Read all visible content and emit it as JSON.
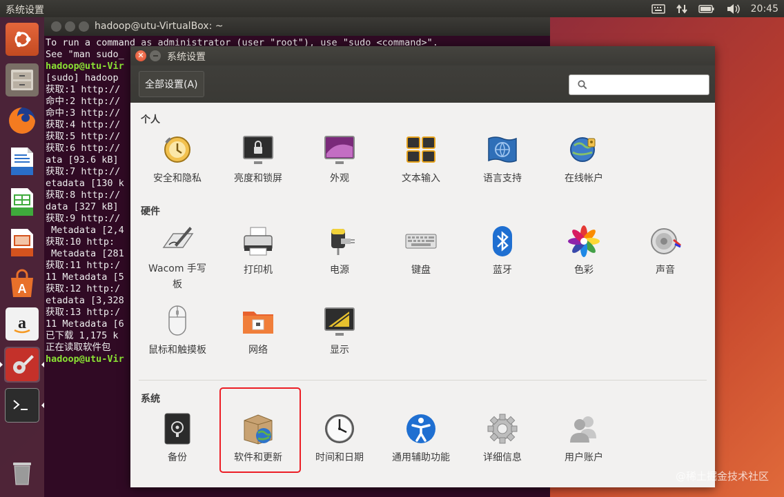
{
  "top_panel": {
    "app_title": "系统设置",
    "clock": "20:45",
    "tray_icons": [
      "keyboard-icon",
      "network-updown-icon",
      "battery-icon",
      "volume-icon"
    ]
  },
  "launcher": {
    "items": [
      {
        "name": "ubuntu-dash-icon"
      },
      {
        "name": "files-icon"
      },
      {
        "name": "firefox-icon"
      },
      {
        "name": "writer-icon"
      },
      {
        "name": "calc-icon"
      },
      {
        "name": "impress-icon"
      },
      {
        "name": "software-center-icon"
      },
      {
        "name": "amazon-icon"
      },
      {
        "name": "system-settings-icon"
      },
      {
        "name": "terminal-icon"
      },
      {
        "name": "trash-icon"
      }
    ]
  },
  "terminal": {
    "title": "hadoop@utu-VirtualBox: ~",
    "lines": [
      {
        "text": "To run a command as administrator (user \"root\"), use \"sudo <command>\".",
        "prompt": false
      },
      {
        "text": "See \"man sudo_",
        "prompt": false
      },
      {
        "text": "",
        "prompt": false
      },
      {
        "text": "hadoop@utu-Vir",
        "prompt": true
      },
      {
        "text": "[sudo] hadoop ",
        "prompt": false
      },
      {
        "text": "获取:1 http://",
        "prompt": false
      },
      {
        "text": "命中:2 http://",
        "prompt": false
      },
      {
        "text": "命中:3 http://",
        "prompt": false
      },
      {
        "text": "获取:4 http://",
        "prompt": false
      },
      {
        "text": "获取:5 http://",
        "prompt": false
      },
      {
        "text": "获取:6 http://",
        "prompt": false
      },
      {
        "text": "ata [93.6 kB]",
        "prompt": false
      },
      {
        "text": "获取:7 http://",
        "prompt": false
      },
      {
        "text": "etadata [130 k",
        "prompt": false
      },
      {
        "text": "获取:8 http://",
        "prompt": false
      },
      {
        "text": "data [327 kB]",
        "prompt": false
      },
      {
        "text": "获取:9 http://",
        "prompt": false
      },
      {
        "text": " Metadata [2,4",
        "prompt": false
      },
      {
        "text": "获取:10 http:",
        "prompt": false
      },
      {
        "text": " Metadata [281",
        "prompt": false
      },
      {
        "text": "获取:11 http:/",
        "prompt": false
      },
      {
        "text": "11 Metadata [5",
        "prompt": false
      },
      {
        "text": "获取:12 http:/",
        "prompt": false
      },
      {
        "text": "etadata [3,328",
        "prompt": false
      },
      {
        "text": "获取:13 http:/",
        "prompt": false
      },
      {
        "text": "11 Metadata [6",
        "prompt": false
      },
      {
        "text": "已下载 1,175 k",
        "prompt": false
      },
      {
        "text": "正在读取软件包",
        "prompt": false
      },
      {
        "text": "hadoop@utu-Vir",
        "prompt": true
      }
    ]
  },
  "settings": {
    "title": "系统设置",
    "all_settings_label": "全部设置(A)",
    "search_placeholder": "",
    "sections": [
      {
        "title": "个人",
        "items": [
          {
            "label": "安全和隐私",
            "icon": "security-privacy-icon"
          },
          {
            "label": "亮度和锁屏",
            "icon": "brightness-lock-icon"
          },
          {
            "label": "外观",
            "icon": "appearance-icon"
          },
          {
            "label": "文本输入",
            "icon": "text-entry-icon"
          },
          {
            "label": "语言支持",
            "icon": "language-support-icon"
          },
          {
            "label": "在线帐户",
            "icon": "online-accounts-icon"
          }
        ]
      },
      {
        "title": "硬件",
        "items": [
          {
            "label": "Wacom 手写板",
            "icon": "wacom-tablet-icon"
          },
          {
            "label": "打印机",
            "icon": "printer-icon"
          },
          {
            "label": "电源",
            "icon": "power-icon"
          },
          {
            "label": "键盘",
            "icon": "keyboard-icon"
          },
          {
            "label": "蓝牙",
            "icon": "bluetooth-icon"
          },
          {
            "label": "色彩",
            "icon": "color-icon"
          },
          {
            "label": "声音",
            "icon": "sound-icon"
          },
          {
            "label": "鼠标和触摸板",
            "icon": "mouse-touchpad-icon"
          },
          {
            "label": "网络",
            "icon": "network-icon"
          },
          {
            "label": "显示",
            "icon": "display-icon"
          }
        ]
      },
      {
        "title": "系统",
        "items": [
          {
            "label": "备份",
            "icon": "backup-icon"
          },
          {
            "label": "软件和更新",
            "icon": "software-updates-icon"
          },
          {
            "label": "时间和日期",
            "icon": "time-date-icon"
          },
          {
            "label": "通用辅助功能",
            "icon": "universal-access-icon"
          },
          {
            "label": "详细信息",
            "icon": "details-icon"
          },
          {
            "label": "用户账户",
            "icon": "user-accounts-icon"
          }
        ]
      }
    ]
  },
  "watermark": "@稀土掘金技术社区",
  "colors": {
    "highlight": "#ec1c24",
    "terminal_bg": "#300a24",
    "prompt": "#8ae234"
  }
}
